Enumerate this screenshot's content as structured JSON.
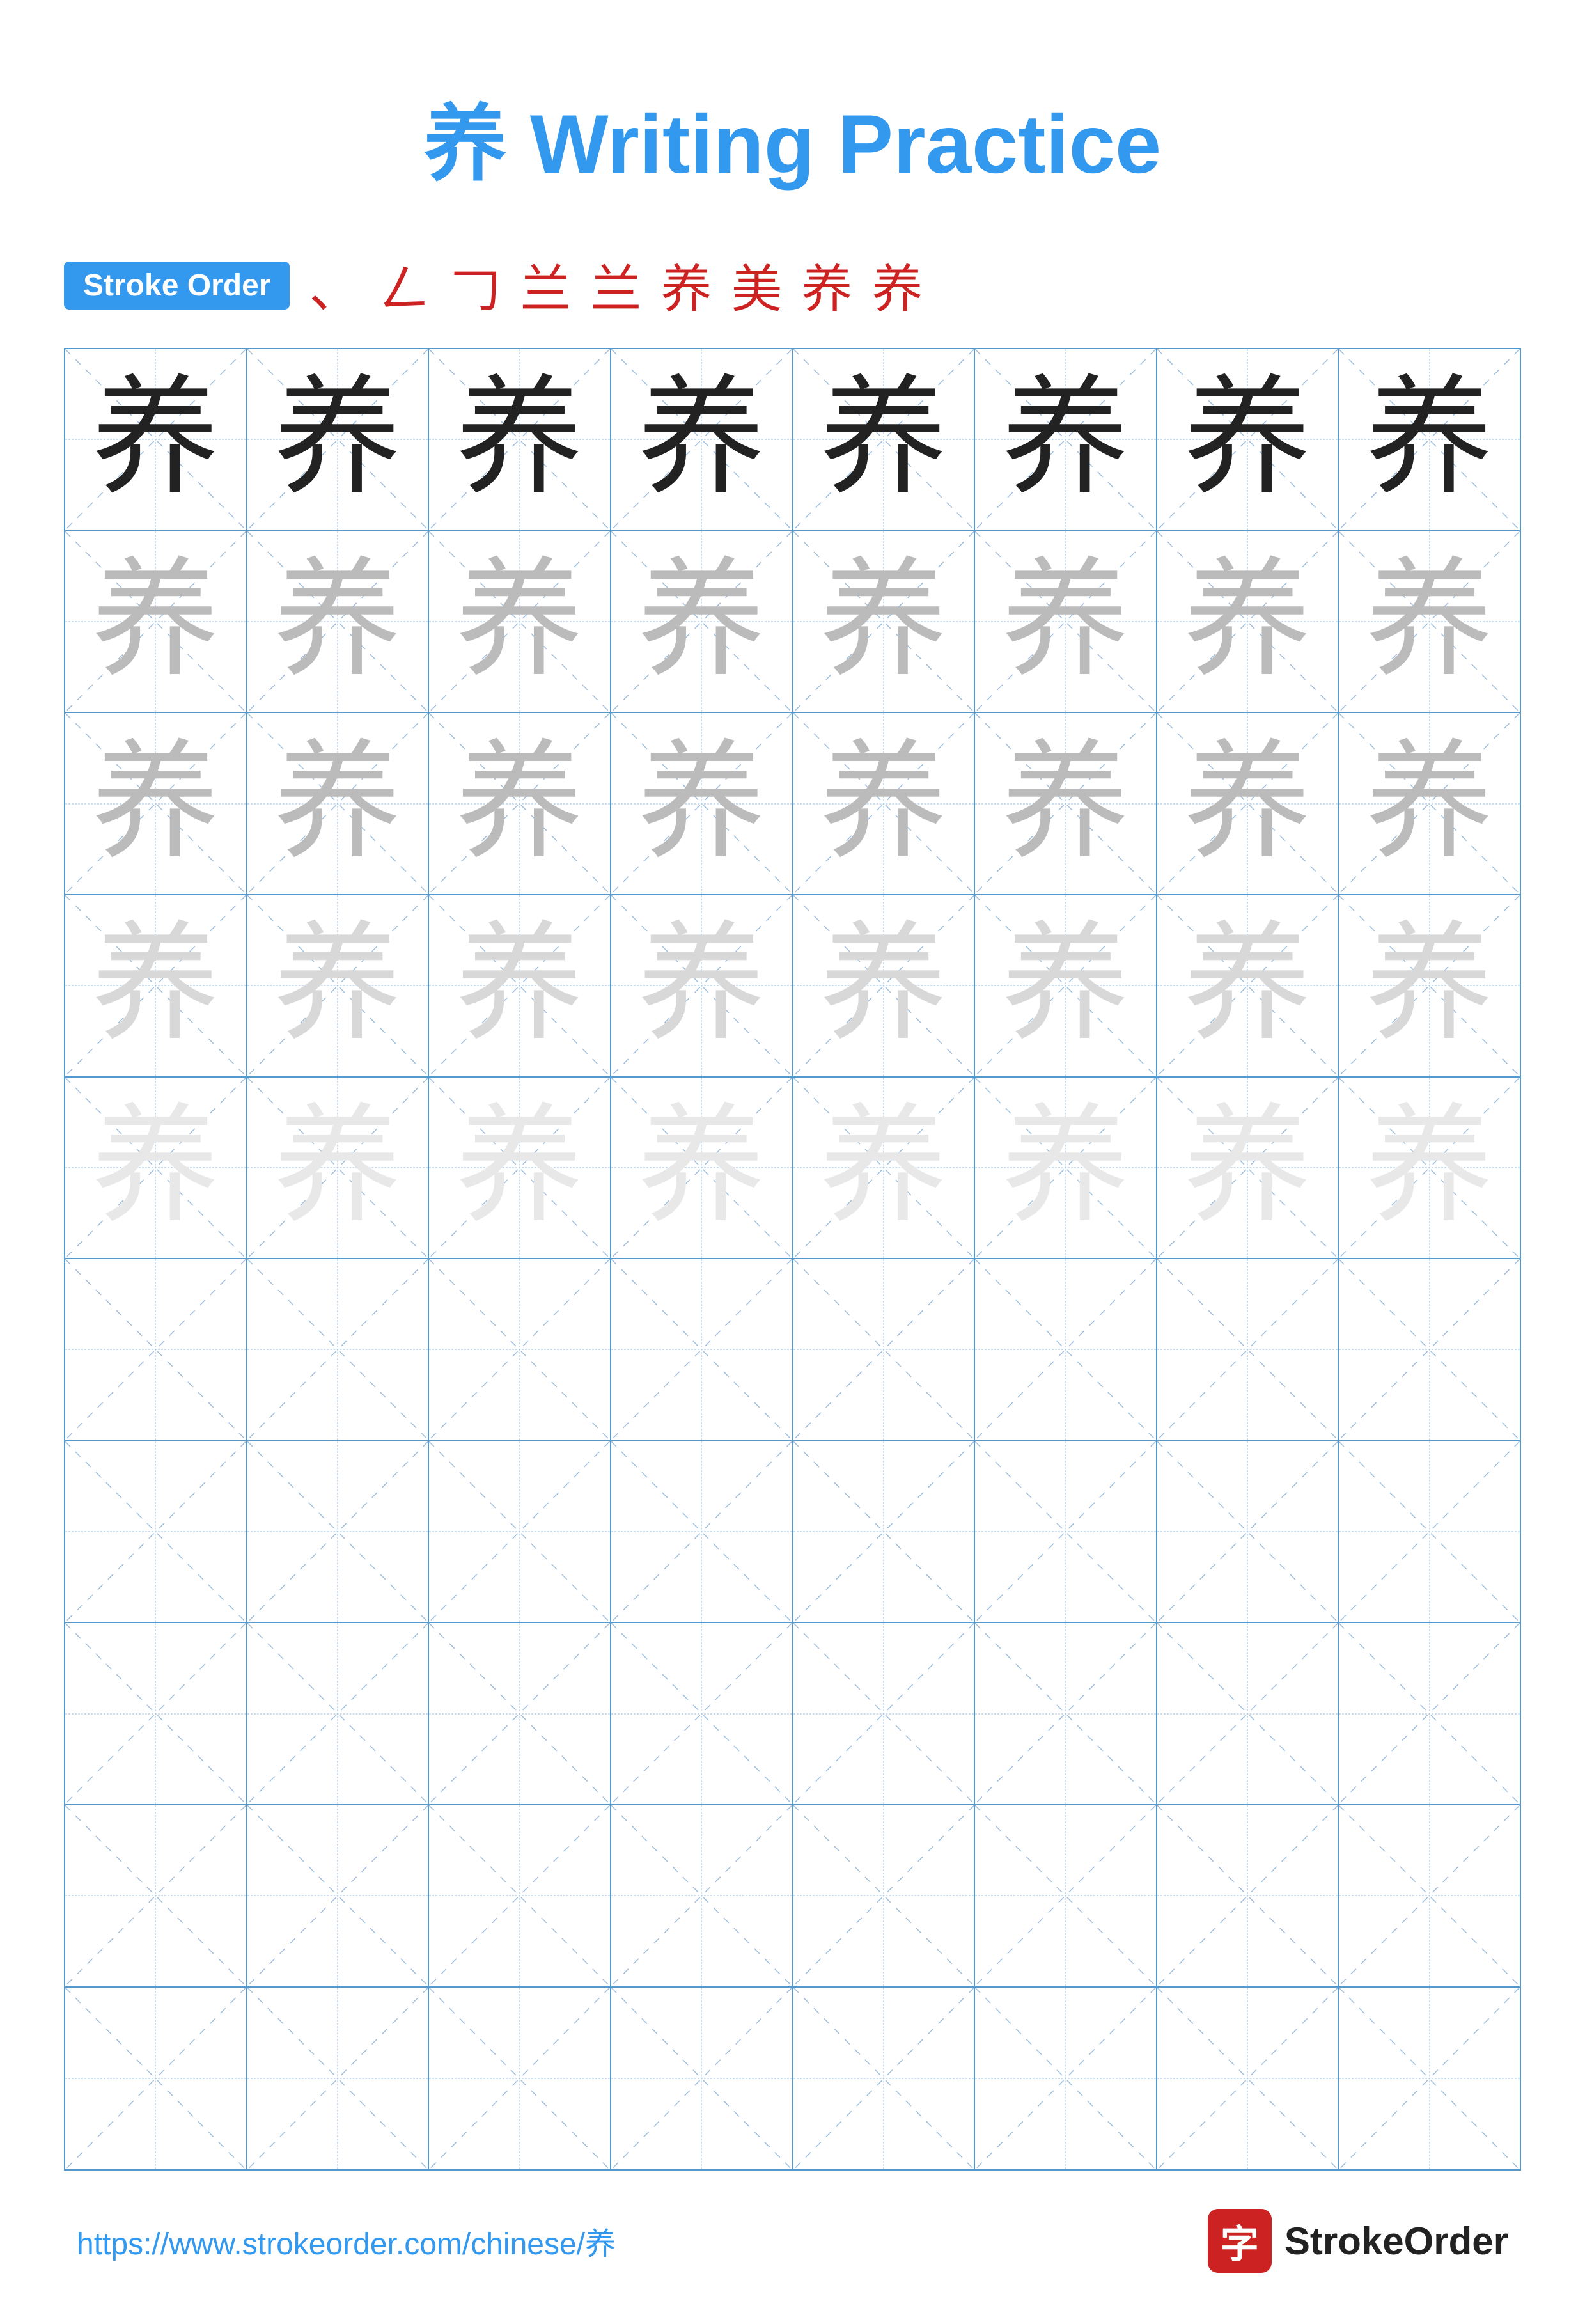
{
  "title": {
    "char": "养",
    "rest": " Writing Practice"
  },
  "stroke_order": {
    "badge_label": "Stroke Order",
    "chars": [
      "、",
      "𠃋",
      "𠃌",
      "兰",
      "兰",
      "养",
      "美",
      "养",
      "养"
    ]
  },
  "grid": {
    "rows": 10,
    "cols": 8,
    "char": "养",
    "char_rows_filled": 5,
    "row_shade": [
      "dark",
      "medium",
      "medium",
      "light",
      "vlight"
    ]
  },
  "footer": {
    "url": "https://www.strokeorder.com/chinese/养",
    "brand_name": "StrokeOrder",
    "logo_char": "字"
  }
}
